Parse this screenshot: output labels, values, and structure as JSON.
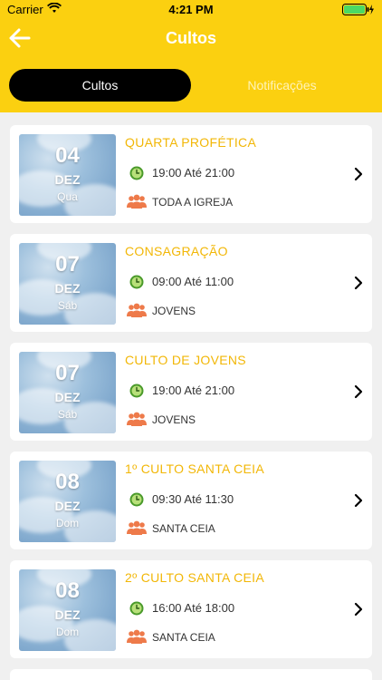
{
  "status": {
    "carrier": "Carrier",
    "time": "4:21 PM"
  },
  "nav": {
    "title": "Cultos"
  },
  "tabs": [
    {
      "label": "Cultos",
      "active": true
    },
    {
      "label": "Notificações",
      "active": false
    }
  ],
  "colors": {
    "brand": "#fbd010",
    "title": "#f2b707",
    "clock": "#4a9a2a",
    "people": "#ee7a4a"
  },
  "services": [
    {
      "day": "04",
      "month": "DEZ",
      "weekday": "Qua",
      "title": "QUARTA PROFÉTICA",
      "time": "19:00 Até 21:00",
      "audience": "TODA A IGREJA"
    },
    {
      "day": "07",
      "month": "DEZ",
      "weekday": "Sáb",
      "title": "CONSAGRAÇÃO",
      "time": "09:00 Até 11:00",
      "audience": "JOVENS"
    },
    {
      "day": "07",
      "month": "DEZ",
      "weekday": "Sáb",
      "title": "CULTO DE JOVENS",
      "time": "19:00 Até 21:00",
      "audience": "JOVENS"
    },
    {
      "day": "08",
      "month": "DEZ",
      "weekday": "Dom",
      "title": "1º CULTO SANTA CEIA",
      "time": "09:30 Até 11:30",
      "audience": "SANTA CEIA"
    },
    {
      "day": "08",
      "month": "DEZ",
      "weekday": "Dom",
      "title": "2º CULTO SANTA CEIA",
      "time": "16:00 Até 18:00",
      "audience": "SANTA CEIA"
    }
  ]
}
